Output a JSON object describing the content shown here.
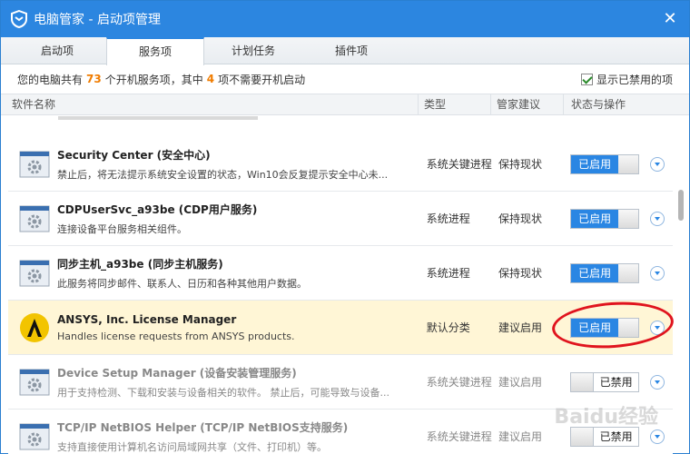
{
  "window": {
    "title": "电脑管家 - 启动项管理",
    "close_glyph": "✕"
  },
  "tabs": [
    {
      "label": "启动项"
    },
    {
      "label": "服务项",
      "active": true
    },
    {
      "label": "计划任务"
    },
    {
      "label": "插件项"
    }
  ],
  "summary": {
    "prefix": "您的电脑共有",
    "total": "73",
    "middle": "个开机服务项，其中",
    "unneeded": "4",
    "suffix": "项不需要开机启动",
    "show_disabled_label": "显示已禁用的项",
    "show_disabled_checked": true
  },
  "columns": {
    "name": "软件名称",
    "type": "类型",
    "advice": "管家建议",
    "status": "状态与操作"
  },
  "rows": [
    {
      "icon": "service-gear-icon",
      "name": "Security Center (安全中心)",
      "desc": "禁止后，将无法提示系统安全设置的状态，Win10会反复提示安全中心未...",
      "type": "系统关键进程",
      "advice": "保持现状",
      "status": "已启用",
      "enabled": true
    },
    {
      "icon": "service-gear-icon",
      "name": "CDPUserSvc_a93be (CDP用户服务)",
      "desc": "连接设备平台服务相关组件。",
      "type": "系统进程",
      "advice": "保持现状",
      "status": "已启用",
      "enabled": true
    },
    {
      "icon": "service-gear-icon",
      "name": "同步主机_a93be (同步主机服务)",
      "desc": "此服务将同步邮件、联系人、日历和各种其他用户数据。",
      "type": "系统进程",
      "advice": "保持现状",
      "status": "已启用",
      "enabled": true
    },
    {
      "icon": "ansys-logo-icon",
      "name": "ANSYS, Inc. License Manager",
      "desc": "Handles license requests from ANSYS products.",
      "type": "默认分类",
      "advice": "建议启用",
      "status": "已启用",
      "enabled": true,
      "highlight": true
    },
    {
      "icon": "service-gear-icon",
      "name": "Device Setup Manager (设备安装管理服务)",
      "desc": "用于支持检测、下载和安装与设备相关的软件。 禁止后，可能导致与设备...",
      "type": "系统关键进程",
      "advice": "建议启用",
      "status": "已禁用",
      "enabled": false
    },
    {
      "icon": "service-gear-icon",
      "name": "TCP/IP NetBIOS Helper (TCP/IP NetBIOS支持服务)",
      "desc": "支持直接使用计算机名访问局域网共享（文件、打印机）等。",
      "type": "系统关键进程",
      "advice": "建议启用",
      "status": "已禁用",
      "enabled": false
    }
  ],
  "colors": {
    "accent": "#2c86e0",
    "toggle_on": "#2a86e3",
    "highlight_row": "#fff6d6",
    "count_number": "#f07c00",
    "annotation_circle": "#e0141e"
  },
  "watermark": "Baidu经验"
}
